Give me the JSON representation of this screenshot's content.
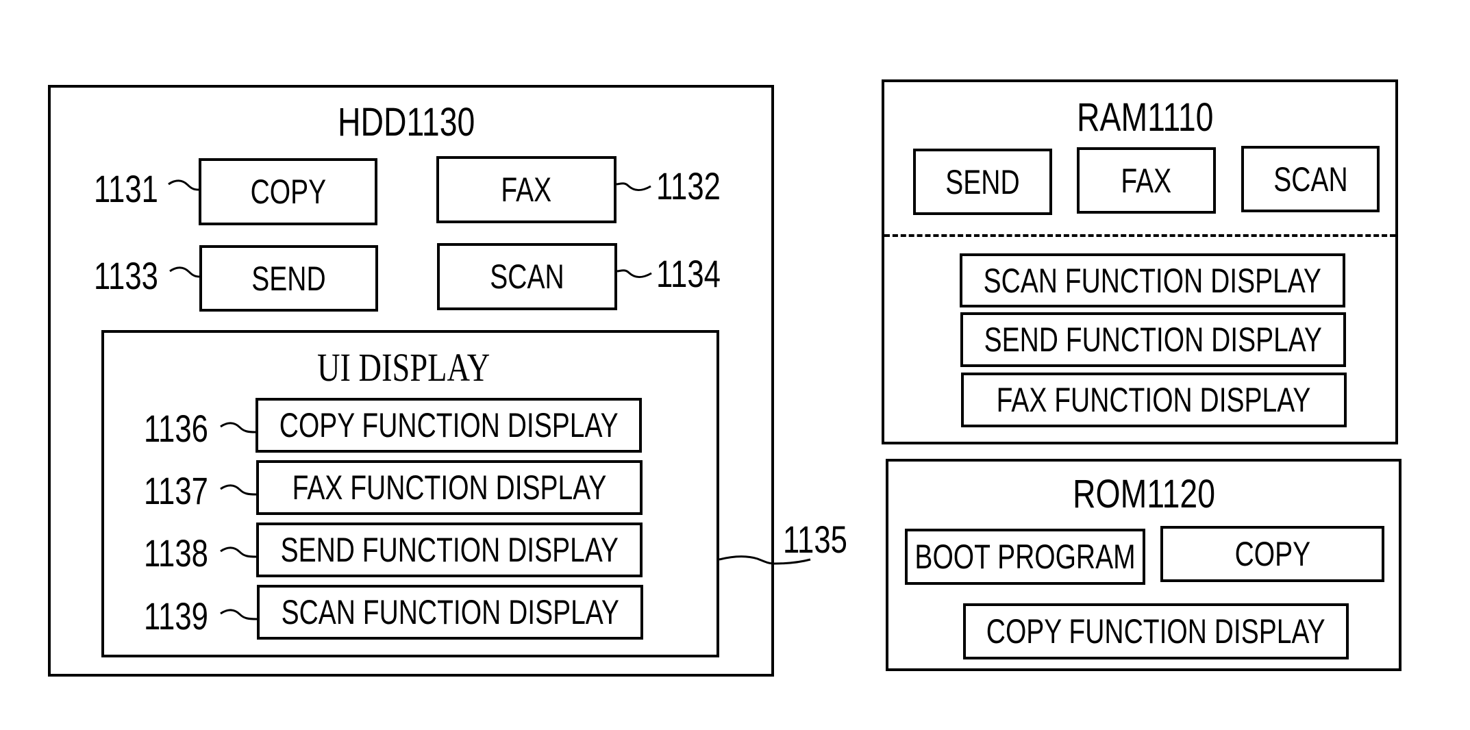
{
  "hdd": {
    "title": "HDD1130",
    "programs": [
      {
        "ref": "1131",
        "label": "COPY"
      },
      {
        "ref": "1132",
        "label": "FAX"
      },
      {
        "ref": "1133",
        "label": "SEND"
      },
      {
        "ref": "1134",
        "label": "SCAN"
      }
    ],
    "ui_display": {
      "ref": "1135",
      "title": "UI DISPLAY",
      "items": [
        {
          "ref": "1136",
          "label": "COPY FUNCTION DISPLAY"
        },
        {
          "ref": "1137",
          "label": "FAX FUNCTION DISPLAY"
        },
        {
          "ref": "1138",
          "label": "SEND FUNCTION DISPLAY"
        },
        {
          "ref": "1139",
          "label": "SCAN FUNCTION DISPLAY"
        }
      ]
    }
  },
  "ram": {
    "title": "RAM1110",
    "programs": [
      "SEND",
      "FAX",
      "SCAN"
    ],
    "displays": [
      "SCAN FUNCTION DISPLAY",
      "SEND FUNCTION DISPLAY",
      "FAX FUNCTION DISPLAY"
    ]
  },
  "rom": {
    "title": "ROM1120",
    "programs": [
      "BOOT PROGRAM",
      "COPY"
    ],
    "displays": [
      "COPY FUNCTION DISPLAY"
    ]
  }
}
